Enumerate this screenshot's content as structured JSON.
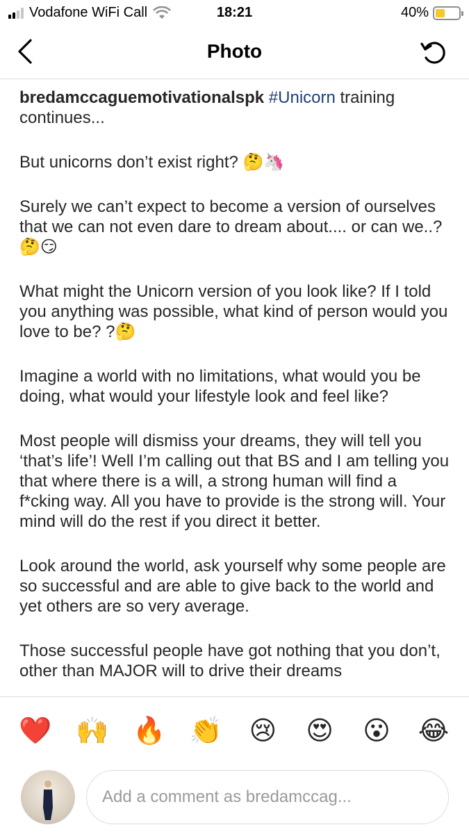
{
  "status_bar": {
    "carrier": "Vodafone WiFi Call",
    "time": "18:21",
    "battery": "40%",
    "battery_level": 0.4
  },
  "nav": {
    "title": "Photo",
    "back_icon": "chevron-left-icon",
    "refresh_icon": "refresh-icon"
  },
  "caption": {
    "username": "bredamccaguemotivationalspk",
    "hashtag": "#Unicorn",
    "first_line_rest": " training continues...",
    "paragraphs": [
      "But unicorns don’t exist right? 🤔🦄",
      "Surely we can’t expect to become a version of ourselves that we can not even dare to dream about.... or can we..?🤔😏",
      "What might the Unicorn version of you look like? If I told you anything was possible, what kind of person would you love to be? ?🤔",
      "Imagine a world with no limitations, what would you be doing, what would your lifestyle look and feel like?",
      "Most people will dismiss your dreams, they will tell you ‘that’s life’! Well I’m calling out that BS and I am telling you that where there is a will, a strong human will find a f*cking way. All you have to provide is the strong will. Your mind will do the rest if you direct it better.",
      "Look around the world, ask yourself why some people are so successful and are able to give back to the world and yet others are so very average.",
      "Those successful people have got nothing that you don’t, other than MAJOR will to drive their dreams"
    ]
  },
  "reactions": [
    "❤️",
    "🙌",
    "🔥",
    "👏",
    "😢",
    "😍",
    "😮",
    "😂"
  ],
  "comment": {
    "placeholder": "Add a comment as bredamccag..."
  },
  "colors": {
    "hashtag": "#1f3f7a",
    "battery_fill": "#f4c92b",
    "divider": "#dbdbdb"
  }
}
